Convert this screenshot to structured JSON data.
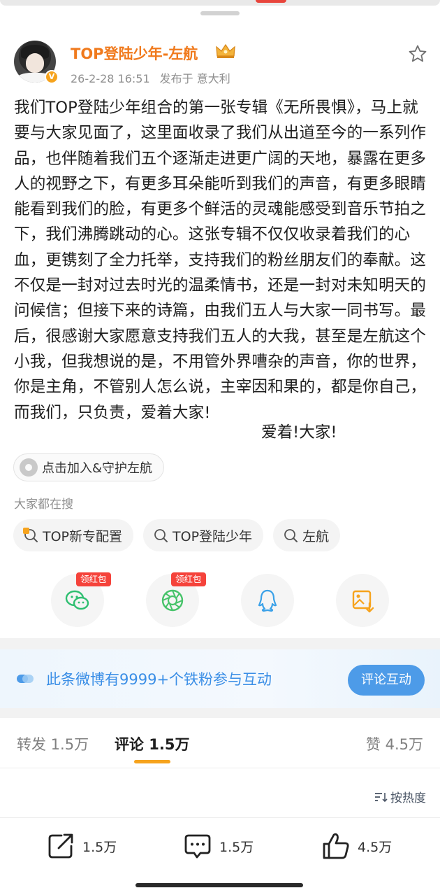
{
  "post": {
    "username": "TOP登陆少年-左航",
    "timestamp": "26-2-28 16:51",
    "location": "发布于 意大利",
    "verified": true,
    "body": "我们TOP登陆少年组合的第一张专辑《无所畏惧》，马上就要与大家见面了，这里面收录了我们从出道至今的一系列作品，也伴随着我们五个逐渐走进更广阔的天地，暴露在更多人的视野之下，有更多耳朵能听到我们的声音，有更多眼睛能看到我们的脸，有更多个鲜活的灵魂能感受到音乐节拍之下，我们沸腾跳动的心。这张专辑不仅仅收录着我们的心血，更镌刻了全力托举，支持我们的粉丝朋友们的奉献。这不仅是一封对过去时光的温柔情书，还是一封对未知明天的问候信；但接下来的诗篇，由我们五人与大家一同书写。最后，很感谢大家愿意支持我们五人的大我，甚至是左航这个小我，但我想说的是，不用管外界嘈杂的声音，你的世界，你是主角，不管别人怎么说，主宰因和果的，都是你自己，而我们，只负责，爱着大家!",
    "sign_off": "爱着!大家!"
  },
  "join_chip": {
    "label": "点击加入&守护左航",
    "icon": "fan-club-icon"
  },
  "search": {
    "heading": "大家都在搜",
    "chips": [
      {
        "label": "TOP新专配置",
        "icon": "hot-search-icon"
      },
      {
        "label": "TOP登陆少年",
        "icon": "search-icon"
      },
      {
        "label": "左航",
        "icon": "search-icon"
      }
    ]
  },
  "share": {
    "items": [
      {
        "name": "wechat",
        "tag": "领红包",
        "icon": "wechat-icon"
      },
      {
        "name": "moments",
        "tag": "领红包",
        "icon": "moments-icon"
      },
      {
        "name": "qq",
        "icon": "qq-icon"
      },
      {
        "name": "save-image",
        "icon": "save-image-icon"
      }
    ]
  },
  "banner": {
    "text": "此条微博有9999+个铁粉参与互动",
    "button": "评论互动"
  },
  "tabs": {
    "repost": "转发 1.5万",
    "comment": "评论 1.5万",
    "like": "赞 4.5万",
    "active": "comment"
  },
  "sort": {
    "label": "按热度"
  },
  "actions": {
    "repost_count": "1.5万",
    "comment_count": "1.5万",
    "like_count": "4.5万"
  },
  "colors": {
    "username": "#f07a1d",
    "accent": "#f6a31d",
    "link": "#3a8ee6",
    "red_tag": "#f5433b"
  }
}
